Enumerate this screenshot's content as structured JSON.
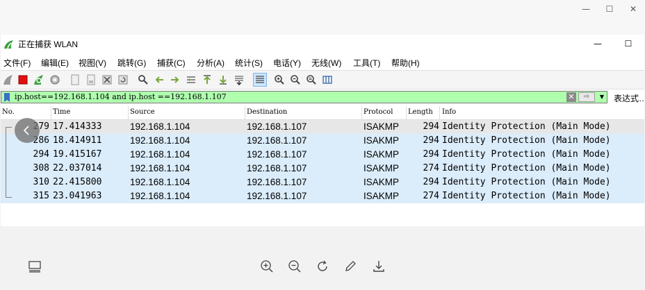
{
  "window": {
    "title": "正在捕获 WLAN",
    "viewer_minimize": "—",
    "viewer_maximize": "☐",
    "viewer_close": "✕",
    "app_minimize": "—",
    "app_maximize": "☐"
  },
  "menu": [
    {
      "label": "文件(F)"
    },
    {
      "label": "编辑(E)"
    },
    {
      "label": "视图(V)"
    },
    {
      "label": "跳转(G)"
    },
    {
      "label": "捕获(C)"
    },
    {
      "label": "分析(A)"
    },
    {
      "label": "统计(S)"
    },
    {
      "label": "电话(Y)"
    },
    {
      "label": "无线(W)"
    },
    {
      "label": "工具(T)"
    },
    {
      "label": "帮助(H)"
    }
  ],
  "filter": {
    "value": "ip.host==192.168.1.104 and ip.host ==192.168.1.107",
    "clear_glyph": "✕",
    "apply_glyph": "⇨",
    "dropdown_glyph": "▼",
    "expression_label": "表达式…"
  },
  "columns": [
    "No.",
    "Time",
    "Source",
    "Destination",
    "Protocol",
    "Length",
    "Info"
  ],
  "packets": [
    {
      "no": "279",
      "time": "17.414333",
      "source": "192.168.1.104",
      "destination": "192.168.1.107",
      "protocol": "ISAKMP",
      "length": "294",
      "info": "Identity Protection (Main Mode)"
    },
    {
      "no": "286",
      "time": "18.414911",
      "source": "192.168.1.104",
      "destination": "192.168.1.107",
      "protocol": "ISAKMP",
      "length": "294",
      "info": "Identity Protection (Main Mode)"
    },
    {
      "no": "294",
      "time": "19.415167",
      "source": "192.168.1.104",
      "destination": "192.168.1.107",
      "protocol": "ISAKMP",
      "length": "294",
      "info": "Identity Protection (Main Mode)"
    },
    {
      "no": "308",
      "time": "22.037014",
      "source": "192.168.1.104",
      "destination": "192.168.1.107",
      "protocol": "ISAKMP",
      "length": "274",
      "info": "Identity Protection (Main Mode)"
    },
    {
      "no": "310",
      "time": "22.415800",
      "source": "192.168.1.104",
      "destination": "192.168.1.107",
      "protocol": "ISAKMP",
      "length": "294",
      "info": "Identity Protection (Main Mode)"
    },
    {
      "no": "315",
      "time": "23.041963",
      "source": "192.168.1.104",
      "destination": "192.168.1.107",
      "protocol": "ISAKMP",
      "length": "274",
      "info": "Identity Protection (Main Mode)"
    }
  ],
  "toolbar_icons": [
    "shark-fin-icon",
    "stop-capture-icon",
    "restart-capture-icon",
    "capture-options-icon",
    "open-file-icon",
    "save-file-icon",
    "close-file-icon",
    "reload-icon",
    "find-packet-icon",
    "go-back-icon",
    "go-forward-icon",
    "go-to-packet-icon",
    "first-packet-icon",
    "last-packet-icon",
    "auto-scroll-icon",
    "colorize-icon",
    "zoom-in-icon",
    "zoom-out-icon",
    "normal-size-icon",
    "resize-columns-icon"
  ],
  "viewer_icons": [
    "thumbnail-icon",
    "zoom-in-icon",
    "zoom-out-icon",
    "rotate-icon",
    "edit-icon",
    "download-icon"
  ],
  "colors": {
    "filter_valid": "#afffaf",
    "row_highlight": "#dbecfa",
    "row_selected": "#e7e7e7",
    "stop_red": "#e01010",
    "shark_green": "#3aa13a"
  }
}
